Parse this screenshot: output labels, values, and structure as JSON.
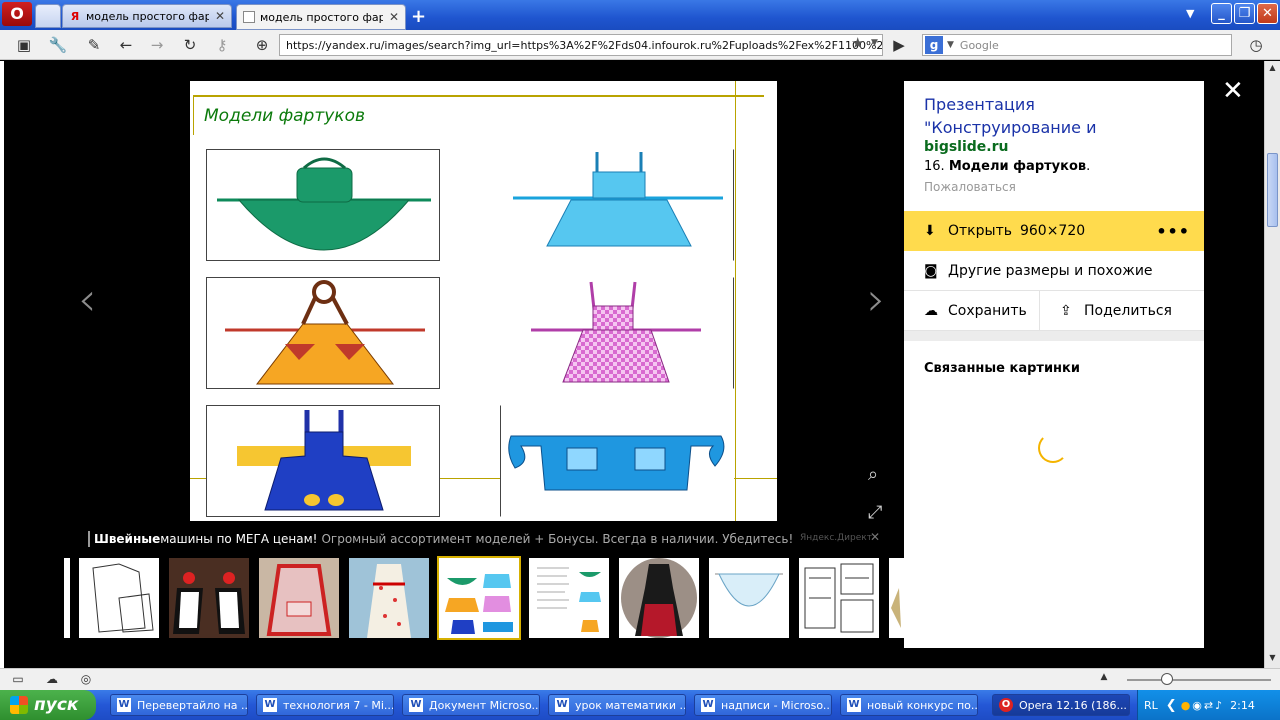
{
  "browser": {
    "tabs": [
      {
        "label": "модель простого фарт...",
        "favicon": "Я",
        "active": false
      },
      {
        "label": "модель простого фарт...",
        "favicon": "page",
        "active": true
      }
    ],
    "url": "https://yandex.ru/images/search?img_url=https%3A%2F%2Fds04.infourok.ru%2Fuploads%2Fex%2F1100%2F00",
    "search_placeholder": "Google",
    "search_engine_letter": "g"
  },
  "slide": {
    "title": "Модели фартуков"
  },
  "ad": {
    "bold": "Швейные",
    "text": " машины по МЕГА ценам!",
    "grey": "Огромный ассортимент моделей + Бонусы. Всегда в наличии. Убедитесь!",
    "source": "Яндекс.Директ"
  },
  "panel": {
    "title": "Презентация \"Конструирование и",
    "site": "bigslide.ru",
    "desc_prefix": "16. ",
    "desc_bold": "Модели фартуков",
    "desc_suffix": ".",
    "complain": "Пожаловаться",
    "open_label": "Открыть",
    "open_size": "960×720",
    "more_label": "•••",
    "other_sizes": "Другие размеры и похожие",
    "save": "Сохранить",
    "share": "Поделиться",
    "related": "Связанные картинки"
  },
  "taskbar": {
    "start": "пуск",
    "tasks": [
      "Перевертайло на ...",
      "технология 7 - Mi...",
      "Документ Microso...",
      "урок математики ...",
      "надписи - Microso...",
      "новый конкурс по...",
      "Opera 12.16 (186..."
    ],
    "lang": "RL",
    "time": "2:14"
  },
  "colors": {
    "yandex_yellow": "#ffdb4d",
    "link_blue": "#1a32a8",
    "site_green": "#0a6b1e",
    "slide_title_green": "#0b7a0b"
  }
}
